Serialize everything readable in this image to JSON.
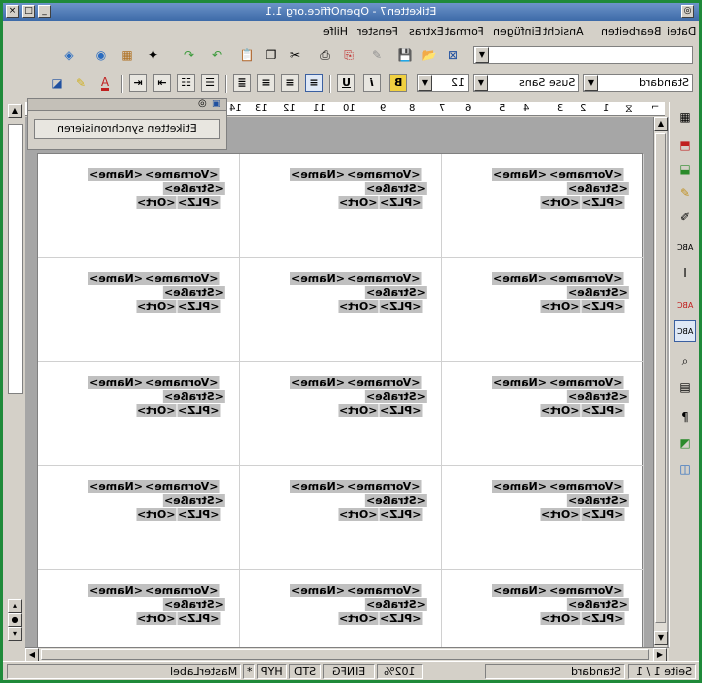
{
  "window": {
    "title": "Etiketten7 - OpenOffice.org 1.1"
  },
  "menu": [
    "Datei",
    "Bearbeiten",
    "Ansicht",
    "Einfügen",
    "Format",
    "Extras",
    "Fenster",
    "Hilfe"
  ],
  "format_bar": {
    "style_value": "Standard",
    "font_value": "Suse Sans",
    "size_value": "12"
  },
  "ruler": {
    "numbers": [
      "1",
      "2",
      "3",
      "4",
      "5",
      "6",
      "7",
      "8",
      "9",
      "10",
      "11",
      "12",
      "13",
      "14"
    ]
  },
  "float_window": {
    "sync_button": "Etiketten synchronisieren"
  },
  "labels": {
    "line1_a": "<Vorname>",
    "line1_b": "<Name>",
    "line2": "<Straße>",
    "line3_a": "<PLZ>",
    "line3_b": "<Ort>"
  },
  "status": {
    "page": "Seite 1 / 1",
    "page_style": "Standard",
    "zoom": "102%",
    "insert_mode": "EINFG",
    "selection_mode": "STD",
    "hyperlink_mode": "HYP",
    "modified": "*",
    "section": "MasterLabel"
  },
  "colors": {
    "title_bar": "#4a76b3",
    "window_border": "#1f8a3a",
    "field_shading": "#c0c0c0"
  }
}
